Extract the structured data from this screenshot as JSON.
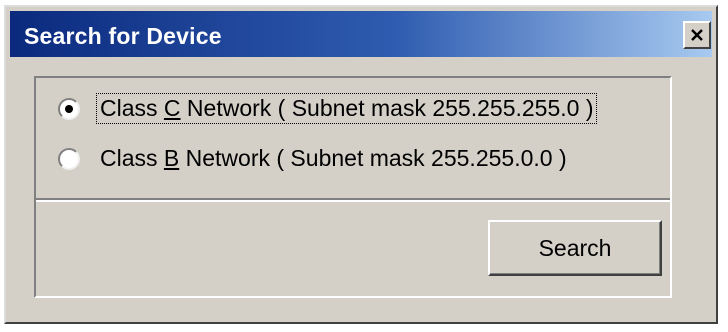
{
  "window": {
    "title": "Search for Device",
    "close_icon": "close-icon"
  },
  "options": [
    {
      "prefix": "Class ",
      "mnemonic": "C",
      "suffix": " Network ( Subnet mask 255.255.255.0 )",
      "selected": true
    },
    {
      "prefix": "Class ",
      "mnemonic": "B",
      "suffix": " Network ( Subnet mask 255.255.0.0 )",
      "selected": false
    }
  ],
  "actions": {
    "search_label": "Search"
  },
  "colors": {
    "face": "#d4d0c8",
    "title_start": "#0b2a7e",
    "title_end": "#a8caf0"
  }
}
